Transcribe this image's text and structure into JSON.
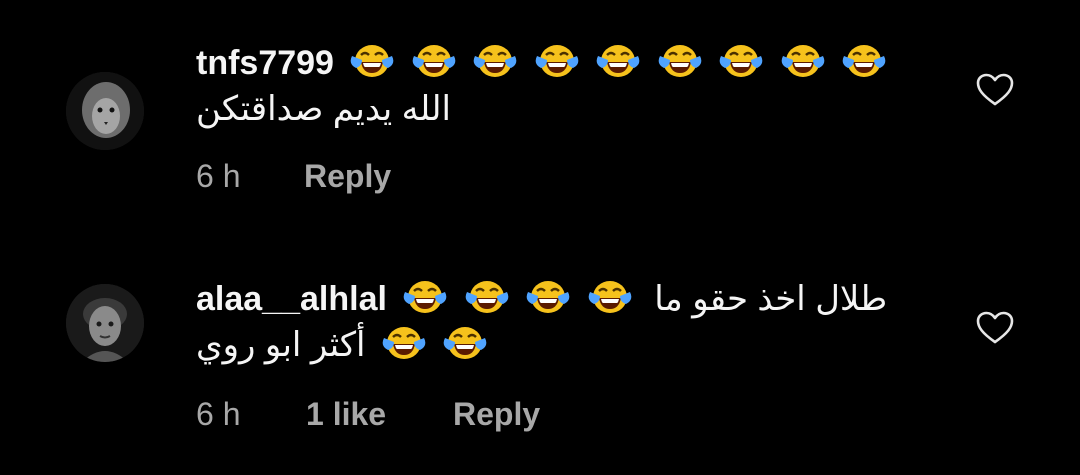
{
  "comments": [
    {
      "username": "tnfs7799",
      "first_line_emojis": 9,
      "text": "الله يديم صداقتكن",
      "time": "6 h",
      "likes": "",
      "reply_label": "Reply",
      "avatar_icon": "lion-photo-avatar",
      "like_icon": "heart-outline-icon"
    },
    {
      "username": "alaa__alhlal",
      "first_line_emojis": 4,
      "text_line1": "طلال اخذ حقو ما",
      "text_line2": "أكثر ابو روي",
      "second_line_emojis": 2,
      "time": "6 h",
      "likes": "1 like",
      "reply_label": "Reply",
      "avatar_icon": "person-photo-avatar",
      "like_icon": "heart-outline-icon"
    }
  ],
  "emoji_name": "face-with-tears-of-joy-icon",
  "colors": {
    "background": "#000000",
    "text": "#f5f5f5",
    "meta": "#a8a8a8"
  }
}
